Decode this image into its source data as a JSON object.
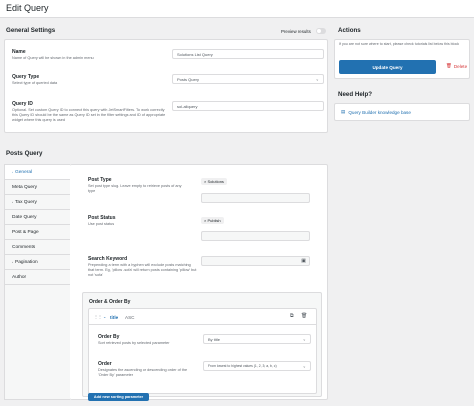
{
  "header": {
    "title": "Edit Query"
  },
  "general": {
    "heading": "General Settings",
    "preview_label": "Preview results",
    "name_label": "Name",
    "name_desc": "Name of Query will be shown in the admin menu",
    "name_value": "Solutions List Query",
    "type_label": "Query Type",
    "type_desc": "Select type of queried data",
    "type_value": "Posts Query",
    "id_label": "Query ID",
    "id_desc": "Optional. Set custom Query ID to connect this query with JetSmartFilters. To work correctly this Query ID should be the same as Query ID set in the filter settings and ID of appropriate widget where this query is used",
    "id_value": "sol-allquery"
  },
  "actions": {
    "heading": "Actions",
    "desc": "If you are not sure where to start, please check tutorials list below this block",
    "update_label": "Update Query",
    "delete_label": "Delete"
  },
  "help": {
    "heading": "Need Help?",
    "link": "Query Builder knowledge base"
  },
  "posts": {
    "heading": "Posts Query",
    "tabs": [
      "General",
      "Meta Query",
      "Tax Query",
      "Date Query",
      "Post & Page",
      "Comments",
      "Pagination",
      "Author"
    ],
    "post_type_label": "Post Type",
    "post_type_desc": "Set post type slug. Leave empty to retrieve posts of any type",
    "post_type_chip": "Solutions",
    "post_status_label": "Post Status",
    "post_status_desc": "Use post status",
    "post_status_chip": "Publish",
    "search_label": "Search Keyword",
    "search_desc": "Prepending a term with a hyphen will exclude posts matching that term. Eg, 'pillow -sofa' will return posts containing 'pillow' but not 'sofa'",
    "order_heading": "Order & Order By",
    "order_item_field": "title",
    "order_item_dir": "ASC",
    "orderby_label": "Order By",
    "orderby_desc": "Sort retrieved posts by selected parameter",
    "orderby_value": "By title",
    "order_label": "Order",
    "order_desc": "Designates the ascending or descending order of the 'Order By' parameter",
    "order_value": "From lowest to highest values (1, 2, 3; a, b, c)",
    "add_sorting_label": "Add new sorting parameter"
  },
  "icons": {
    "chevron": "chevron-down-icon",
    "trash": "trash-icon",
    "copy": "copy-icon",
    "drag": "drag-handle-icon",
    "doc": "document-icon",
    "search": "search-field-icon"
  },
  "colors": {
    "accent": "#2271b1",
    "danger": "#d63638"
  }
}
